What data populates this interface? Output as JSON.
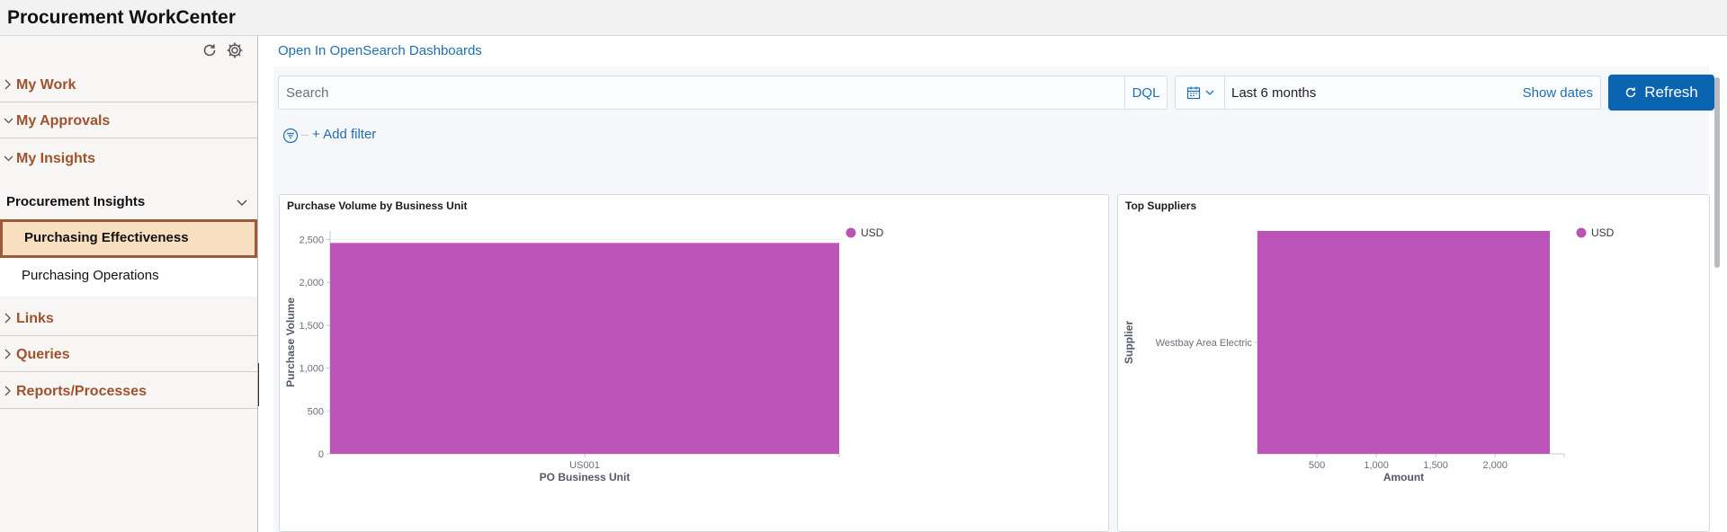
{
  "app": {
    "title": "Procurement WorkCenter"
  },
  "sidebar": {
    "sections": [
      {
        "label": "My Work",
        "expanded": false
      },
      {
        "label": "My Approvals",
        "expanded": true
      },
      {
        "label": "My Insights",
        "expanded": true
      }
    ],
    "insights_group": {
      "title": "Procurement Insights"
    },
    "insights_items": [
      {
        "label": "Purchasing Effectiveness",
        "selected": true
      },
      {
        "label": "Purchasing Operations",
        "selected": false
      }
    ],
    "bottom_sections": [
      {
        "label": "Links",
        "expanded": false
      },
      {
        "label": "Queries",
        "expanded": false
      },
      {
        "label": "Reports/Processes",
        "expanded": false
      }
    ]
  },
  "main": {
    "open_link": "Open In OpenSearch Dashboards",
    "search": {
      "placeholder": "Search",
      "value": "",
      "query_language": "DQL"
    },
    "date": {
      "range": "Last 6 months",
      "show_dates": "Show dates"
    },
    "refresh_label": "Refresh",
    "add_filter_label": "+ Add filter"
  },
  "chart_data": [
    {
      "type": "bar",
      "title": "Purchase Volume by Business Unit",
      "xlabel": "PO Business Unit",
      "ylabel": "Purchase Volume",
      "categories": [
        "US001"
      ],
      "series": [
        {
          "name": "USD",
          "values": [
            2460
          ]
        }
      ],
      "ylim": [
        0,
        2600
      ],
      "yticks": [
        0,
        500,
        1000,
        1500,
        2000,
        2500
      ],
      "ytick_labels": [
        "0",
        "500",
        "1,000",
        "1,500",
        "2,000",
        "2,500"
      ],
      "legend": "top-right",
      "color": "#bb53b9"
    },
    {
      "type": "bar",
      "orientation": "horizontal",
      "title": "Top Suppliers",
      "xlabel": "Amount",
      "ylabel": "Supplier",
      "categories": [
        "Westbay Area Electric"
      ],
      "series": [
        {
          "name": "USD",
          "values": [
            2460
          ]
        }
      ],
      "xlim": [
        0,
        2460
      ],
      "xticks": [
        500,
        1000,
        1500,
        2000
      ],
      "xtick_labels": [
        "500",
        "1,000",
        "1,500",
        "2,000"
      ],
      "legend": "top-right",
      "color": "#bb53b9"
    }
  ]
}
